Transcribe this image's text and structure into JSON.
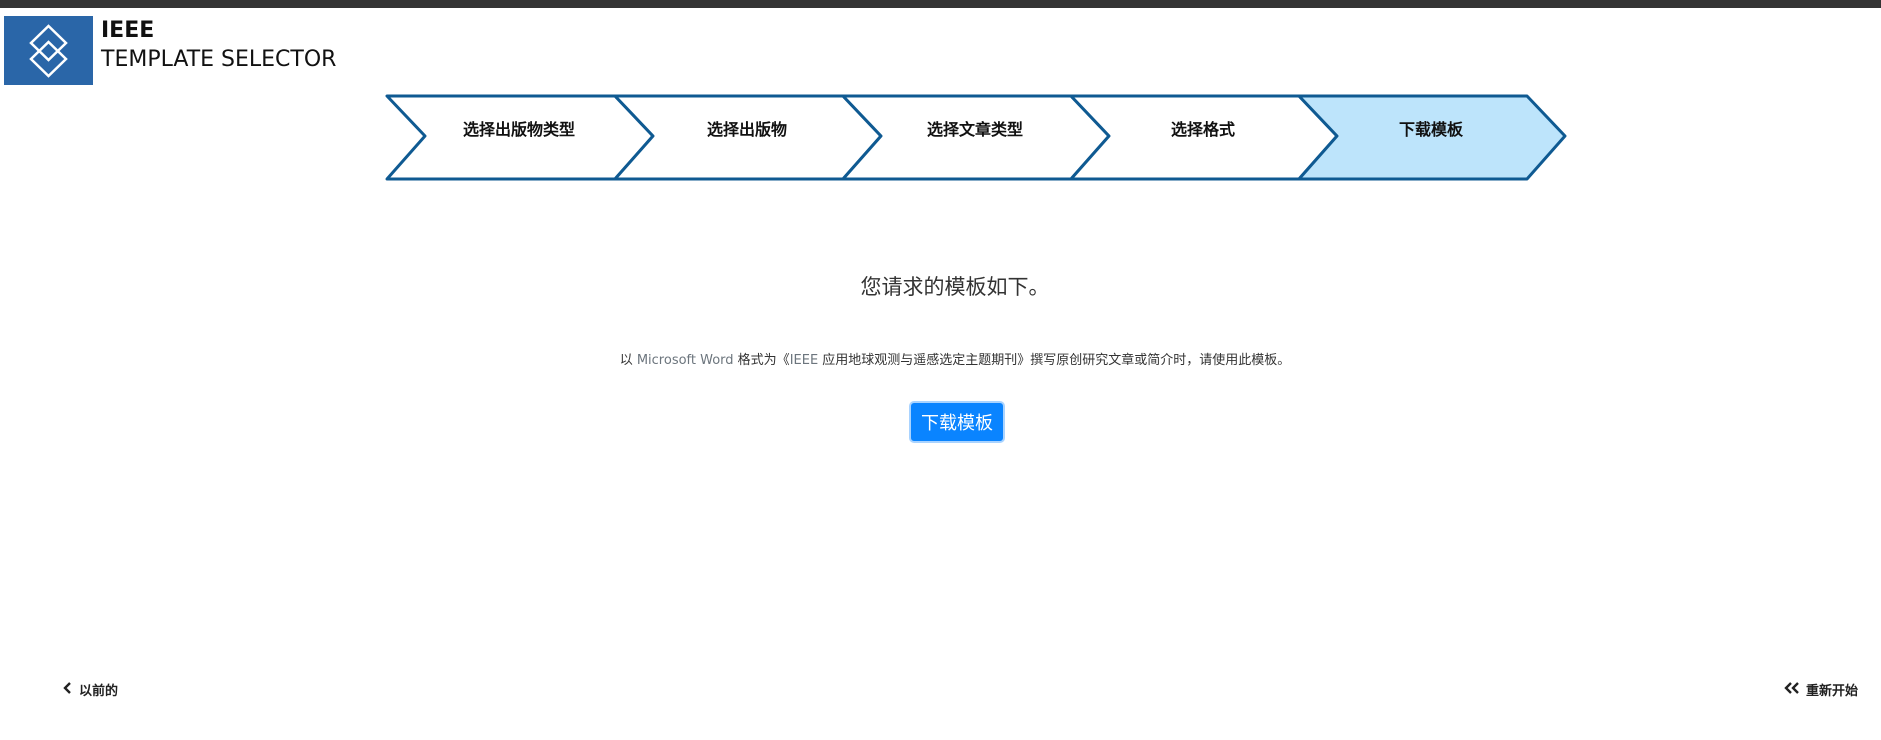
{
  "brand": {
    "line1": "IEEE",
    "line2": "TEMPLATE SELECTOR"
  },
  "steps": [
    {
      "label": "选择出版物类型",
      "active": false
    },
    {
      "label": "选择出版物",
      "active": false
    },
    {
      "label": "选择文章类型",
      "active": false
    },
    {
      "label": "选择格式",
      "active": false
    },
    {
      "label": "下载模板",
      "active": true
    }
  ],
  "main": {
    "heading": "您请求的模板如下。",
    "desc_prefix": "以 ",
    "desc_format": "Microsoft Word",
    "desc_middle": " 格式为《",
    "desc_journal_en": "IEEE",
    "desc_suffix": " 应用地球观测与遥感选定主题期刊》撰写原创研究文章或简介时，请使用此模板。",
    "download_label": "下载模板"
  },
  "nav": {
    "prev_label": "以前的",
    "restart_label": "重新开始"
  },
  "colors": {
    "accent": "#0a84ff",
    "step_active_fill": "#bde4fb",
    "step_border": "#0f5a92",
    "logo_bg": "#2a66a8"
  }
}
